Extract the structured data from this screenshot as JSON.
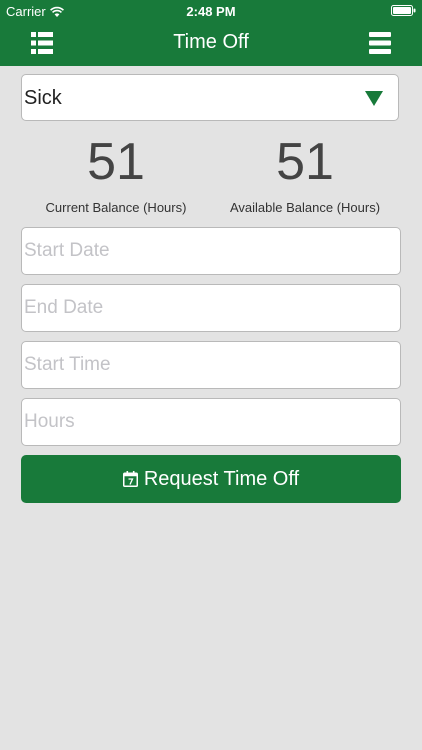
{
  "status_bar": {
    "carrier": "Carrier",
    "time": "2:48 PM"
  },
  "nav": {
    "title": "Time Off",
    "left_icon": "list-icon",
    "right_icon": "menu-icon"
  },
  "leave_type": {
    "selected": "Sick"
  },
  "balances": {
    "current_value": "51",
    "current_label": "Current Balance (Hours)",
    "available_value": "51",
    "available_label": "Available Balance (Hours)"
  },
  "form": {
    "start_date_placeholder": "Start Date",
    "end_date_placeholder": "End Date",
    "start_time_placeholder": "Start Time",
    "hours_placeholder": "Hours"
  },
  "request_button": {
    "label": "Request Time Off",
    "icon": "calendar-icon"
  },
  "colors": {
    "brand_green": "#187a3a",
    "background": "#e3e3e3"
  }
}
